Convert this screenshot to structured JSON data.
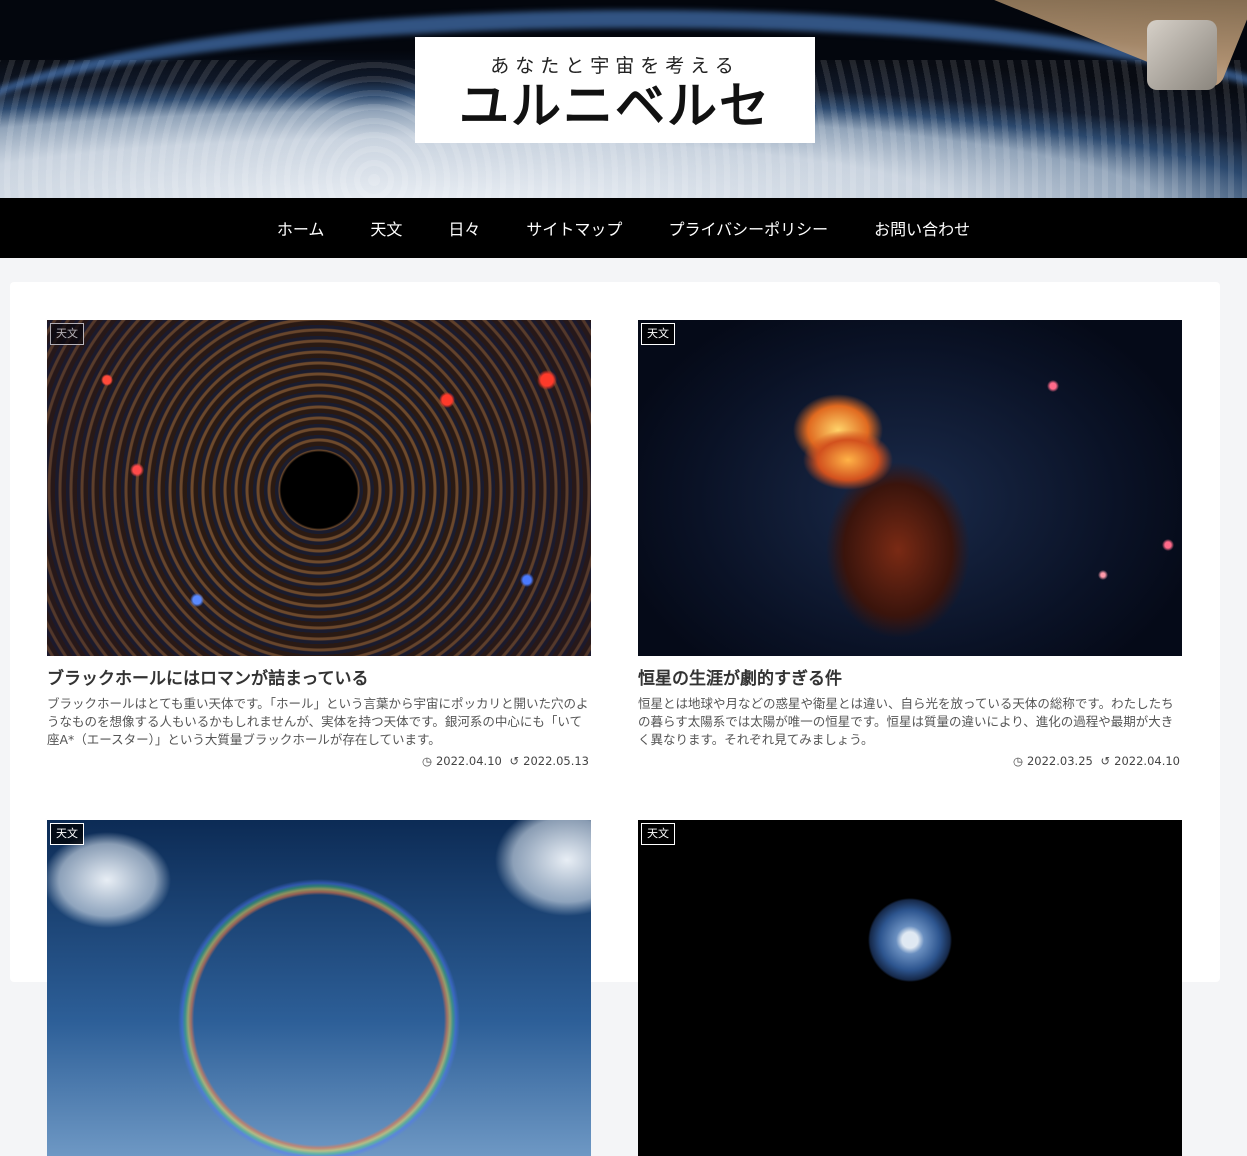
{
  "site": {
    "tagline": "あなたと宇宙を考える",
    "title": "ユルニベルセ"
  },
  "nav": {
    "items": [
      {
        "label": "ホーム"
      },
      {
        "label": "天文"
      },
      {
        "label": "日々"
      },
      {
        "label": "サイトマップ"
      },
      {
        "label": "プライバシーポリシー"
      },
      {
        "label": "お問い合わせ"
      }
    ]
  },
  "posts": [
    {
      "category": "天文",
      "title": "ブラックホールにはロマンが詰まっている",
      "excerpt": "ブラックホールはとても重い天体です。「ホール」という言葉から宇宙にポッカリと開いた穴のようなものを想像する人もいるかもしれませんが、実体を持つ天体です。銀河系の中心にも「いて座A*（エースター）」という大質量ブラックホールが存在しています。",
      "published": "2022.04.10",
      "updated": "2022.05.13"
    },
    {
      "category": "天文",
      "title": "恒星の生涯が劇的すぎる件",
      "excerpt": "恒星とは地球や月などの惑星や衛星とは違い、自ら光を放っている天体の総称です。わたしたちの暮らす太陽系では太陽が唯一の恒星です。恒星は質量の違いにより、進化の過程や最期が大きく異なります。それぞれ見てみましょう。",
      "published": "2022.03.25",
      "updated": "2022.04.10"
    },
    {
      "category": "天文"
    },
    {
      "category": "天文"
    }
  ],
  "icons": {
    "published": "clock-icon",
    "updated": "history-icon"
  }
}
